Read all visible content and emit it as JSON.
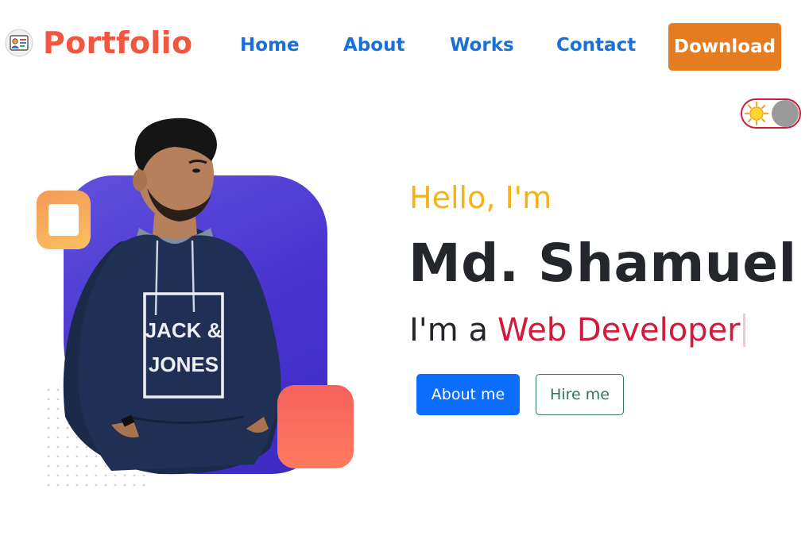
{
  "header": {
    "brand": {
      "name": "Portfolio",
      "logo_icon": "portfolio-logo-icon",
      "color": "#f0573e"
    },
    "nav": [
      {
        "label": "Home"
      },
      {
        "label": "About"
      },
      {
        "label": "Works"
      },
      {
        "label": "Contact"
      }
    ],
    "download_label": "Download",
    "nav_color": "#1a6fd8",
    "download_color": "#e57c22"
  },
  "theme_toggle": {
    "icon": "sun-icon",
    "border_color": "#c81e3c",
    "state": "light"
  },
  "hero": {
    "greeting": "Hello, I'm",
    "name": "Md. Shamuel",
    "role_prefix": "I'm a",
    "role_highlight": "Web Developer",
    "buttons": {
      "about_label": "About me",
      "hire_label": "Hire me"
    },
    "colors": {
      "greeting": "#f6b315",
      "name": "#23262b",
      "role_highlight": "#d31a3c",
      "about_button": "#0d6efd",
      "hire_button_outline": "#2d7a54",
      "shape_blue": "#4a33cf",
      "shape_orange": "#fbc05e",
      "shape_red": "#f4625c"
    },
    "photo": {
      "shirt_text_line1": "JACK &",
      "shirt_text_line2": "JONES"
    }
  }
}
